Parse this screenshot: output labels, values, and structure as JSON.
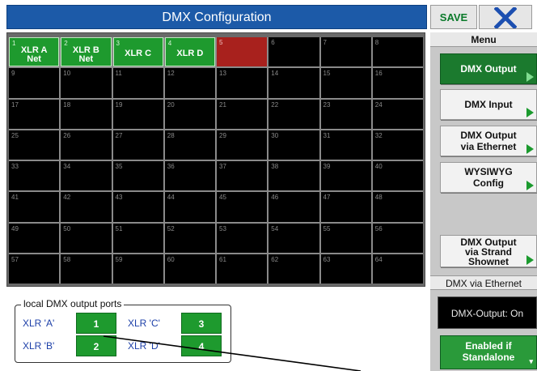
{
  "window": {
    "title": "DMX Configuration",
    "save_label": "SAVE"
  },
  "grid": {
    "cells": [
      {
        "n": "1",
        "name": "XLR A\nNet",
        "type": "xlr"
      },
      {
        "n": "2",
        "name": "XLR B\nNet",
        "type": "xlr"
      },
      {
        "n": "3",
        "name": "XLR C",
        "type": "xlr"
      },
      {
        "n": "4",
        "name": "XLR D",
        "type": "xlr"
      },
      {
        "n": "5",
        "name": "",
        "type": "red"
      },
      {
        "n": "6"
      },
      {
        "n": "7"
      },
      {
        "n": "8"
      },
      {
        "n": "9"
      },
      {
        "n": "10"
      },
      {
        "n": "11"
      },
      {
        "n": "12"
      },
      {
        "n": "13"
      },
      {
        "n": "14"
      },
      {
        "n": "15"
      },
      {
        "n": "16"
      },
      {
        "n": "17"
      },
      {
        "n": "18"
      },
      {
        "n": "19"
      },
      {
        "n": "20"
      },
      {
        "n": "21"
      },
      {
        "n": "22"
      },
      {
        "n": "23"
      },
      {
        "n": "24"
      },
      {
        "n": "25"
      },
      {
        "n": "26"
      },
      {
        "n": "27"
      },
      {
        "n": "28"
      },
      {
        "n": "29"
      },
      {
        "n": "30"
      },
      {
        "n": "31"
      },
      {
        "n": "32"
      },
      {
        "n": "33"
      },
      {
        "n": "34"
      },
      {
        "n": "35"
      },
      {
        "n": "36"
      },
      {
        "n": "37"
      },
      {
        "n": "38"
      },
      {
        "n": "39"
      },
      {
        "n": "40"
      },
      {
        "n": "41"
      },
      {
        "n": "42"
      },
      {
        "n": "43"
      },
      {
        "n": "44"
      },
      {
        "n": "45"
      },
      {
        "n": "46"
      },
      {
        "n": "47"
      },
      {
        "n": "48"
      },
      {
        "n": "49"
      },
      {
        "n": "50"
      },
      {
        "n": "51"
      },
      {
        "n": "52"
      },
      {
        "n": "53"
      },
      {
        "n": "54"
      },
      {
        "n": "55"
      },
      {
        "n": "56"
      },
      {
        "n": "57"
      },
      {
        "n": "58"
      },
      {
        "n": "59"
      },
      {
        "n": "60"
      },
      {
        "n": "61"
      },
      {
        "n": "62"
      },
      {
        "n": "63"
      },
      {
        "n": "64"
      }
    ]
  },
  "sidebar": {
    "menu_header": "Menu",
    "items": [
      {
        "label": "DMX Output",
        "active": true
      },
      {
        "label": "DMX Input",
        "active": false
      },
      {
        "label": "DMX Output\nvia Ethernet",
        "active": false
      },
      {
        "label": "WYSIWYG\nConfig",
        "active": false
      },
      {
        "label": "DMX Output\nvia Strand\nShownet",
        "active": false
      }
    ],
    "section_header": "DMX via Ethernet",
    "status": "DMX-Output: On",
    "standalone_label": "Enabled if\nStandalone"
  },
  "ports": {
    "legend": "local DMX output ports",
    "a_label": "XLR 'A'",
    "b_label": "XLR 'B'",
    "c_label": "XLR 'C'",
    "d_label": "XLR 'D'",
    "a_value": "1",
    "b_value": "2",
    "c_value": "3",
    "d_value": "4"
  },
  "colors": {
    "title_bar": "#1c5aa8",
    "xlr_green": "#1e9a2e",
    "active_red": "#a8211d",
    "close_x": "#1c4fb0"
  },
  "icons": {
    "close": "close-x-icon",
    "arrow": "play-arrow-icon"
  }
}
